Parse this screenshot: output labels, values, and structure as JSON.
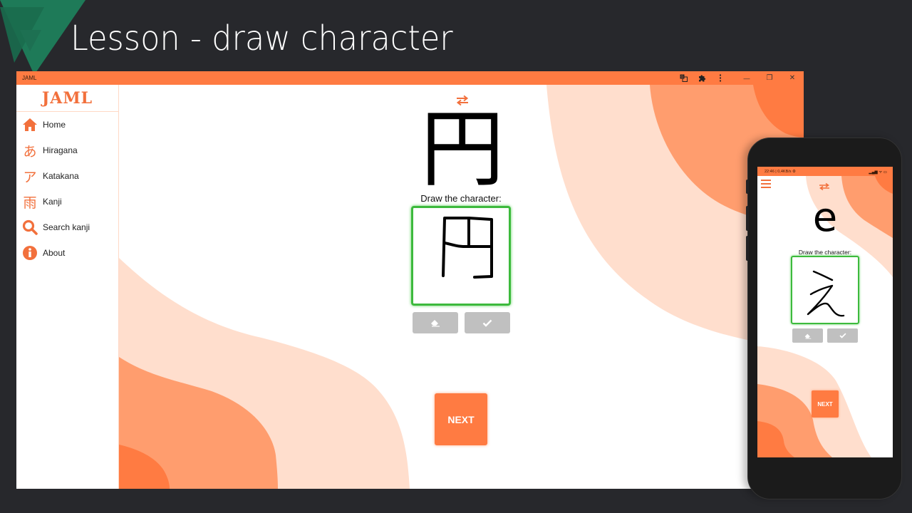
{
  "slide": {
    "title": "Lesson - draw character"
  },
  "window": {
    "app_name": "JAML",
    "titlebar_icons": [
      "translate-icon",
      "extension-icon",
      "more-vertical-icon"
    ],
    "controls": {
      "minimize": "—",
      "maximize": "❐",
      "close": "✕"
    }
  },
  "sidebar": {
    "logo": "JAML",
    "items": [
      {
        "label": "Home",
        "icon": "home-icon",
        "glyph": ""
      },
      {
        "label": "Hiragana",
        "icon": "hiragana-icon",
        "glyph": "あ"
      },
      {
        "label": "Katakana",
        "icon": "katakana-icon",
        "glyph": "ア"
      },
      {
        "label": "Kanji",
        "icon": "kanji-icon",
        "glyph": "雨"
      },
      {
        "label": "Search kanji",
        "icon": "search-icon",
        "glyph": ""
      },
      {
        "label": "About",
        "icon": "info-icon",
        "glyph": ""
      }
    ]
  },
  "lesson": {
    "character": "円",
    "prompt": "Draw the character:",
    "erase_icon": "eraser-icon",
    "check_icon": "check-icon",
    "next_label": "NEXT"
  },
  "phone": {
    "status_left": "22:46 | 0,4KB/s ⚙",
    "status_right": "▂▄▆ ᯤ ▭",
    "character": "e",
    "prompt": "Draw the character:",
    "next_label": "NEXT"
  },
  "colors": {
    "accent": "#ff7b42",
    "accent_mid": "#ff9d6e",
    "accent_light": "#ffdecd",
    "canvas_border": "#3dba3d",
    "tool_button": "#c0c0c0",
    "slide_bg": "#27282c",
    "deco_green": "#1e7a58"
  }
}
